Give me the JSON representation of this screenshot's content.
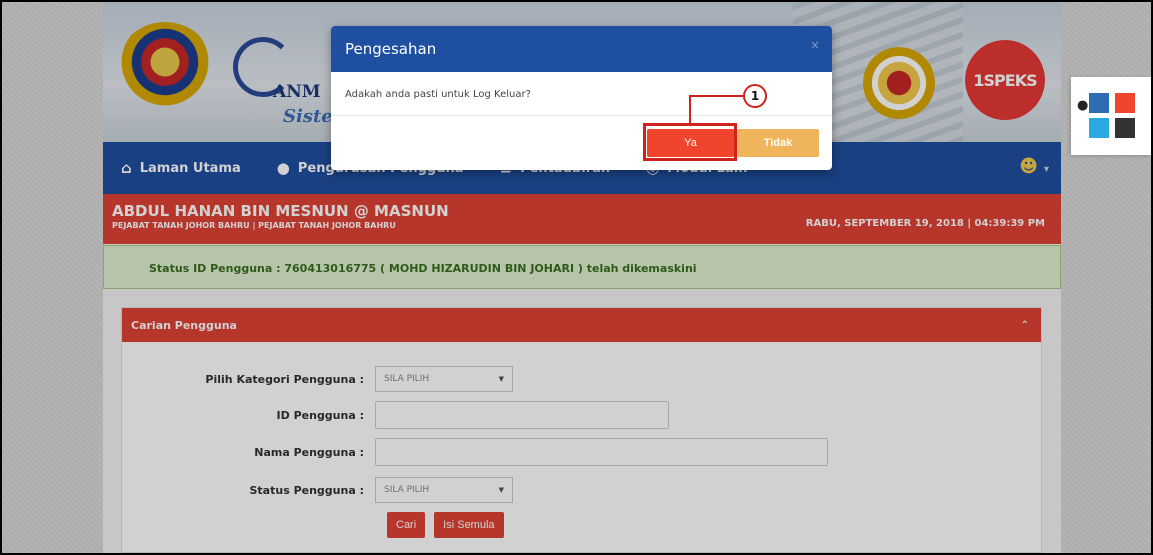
{
  "navbar": {
    "items": [
      {
        "icon": "home-icon",
        "label": "Laman Utama"
      },
      {
        "icon": "user-icon",
        "label": "Pengurusan Pengguna"
      },
      {
        "icon": "list-icon",
        "label": "Pentadbiran"
      },
      {
        "icon": "globe-icon",
        "label": "Modul Lain"
      }
    ],
    "user_icon": "user-avatar-icon"
  },
  "banner": {
    "anm": "ANM",
    "sistem": "Sistem",
    "speks": "1SPEKS"
  },
  "userbar": {
    "name": "ABDUL HANAN BIN MESNUN @ MASNUN",
    "office": "PEJABAT TANAH JOHOR BAHRU | PEJABAT TANAH JOHOR BAHRU",
    "datetime": "RABU, SEPTEMBER 19, 2018 | 04:39:39 PM"
  },
  "alert": {
    "message": "Status ID Pengguna : 760413016775 ( MOHD HIZARUDIN BIN JOHARI ) telah dikemaskini"
  },
  "panel": {
    "title": "Carian Pengguna",
    "fields": {
      "kategori_label": "Pilih Kategori Pengguna :",
      "kategori_value": "SILA PILIH",
      "id_label": "ID Pengguna :",
      "id_value": "",
      "nama_label": "Nama Pengguna :",
      "nama_value": "",
      "status_label": "Status Pengguna :",
      "status_value": "SILA PILIH"
    },
    "buttons": {
      "search": "Cari",
      "reset": "Isi Semula"
    }
  },
  "modal": {
    "title": "Pengesahan",
    "close": "×",
    "message": "Adakah anda pasti untuk Log Keluar?",
    "yes": "Ya",
    "no": "Tidak"
  },
  "annotation": {
    "step": "1"
  },
  "theme_picker": {
    "icon": "droplet-icon",
    "colors": [
      "#2e6db4",
      "#f0452c",
      "#29a9e0",
      "#333333"
    ]
  }
}
